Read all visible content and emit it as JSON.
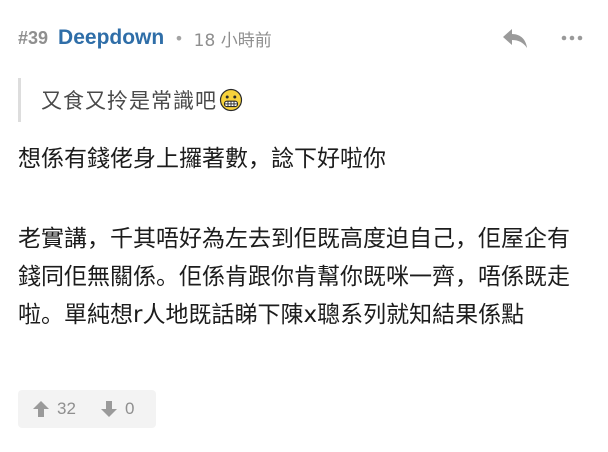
{
  "post": {
    "number": "#39",
    "username": "Deepdown",
    "separator": "•",
    "time": "18 小時前",
    "icons": {
      "reply": "reply-icon",
      "more": "more-icon",
      "emoji": "grimacing-face-emoji-icon",
      "upvote": "upvote-arrow-icon",
      "downvote": "downvote-arrow-icon"
    },
    "quote_text": "又食又拎是常識吧",
    "content": {
      "paragraph1": "想係有錢佬身上攞著數，諗下好啦你",
      "paragraph2": "老實講，千其唔好為左去到佢既高度迫自己，佢屋企有錢同佢無關係。佢係肯跟你肯幫你既咪一齊，唔係既走啦。單純想r人地既話睇下陳x聰系列就知結果係點"
    },
    "votes": {
      "up": "32",
      "down": "0"
    },
    "colors": {
      "username": "#2f6ea8",
      "meta": "#8f8f8f",
      "quote_border": "#dddddd",
      "vote_bg": "#f3f3f3"
    }
  }
}
